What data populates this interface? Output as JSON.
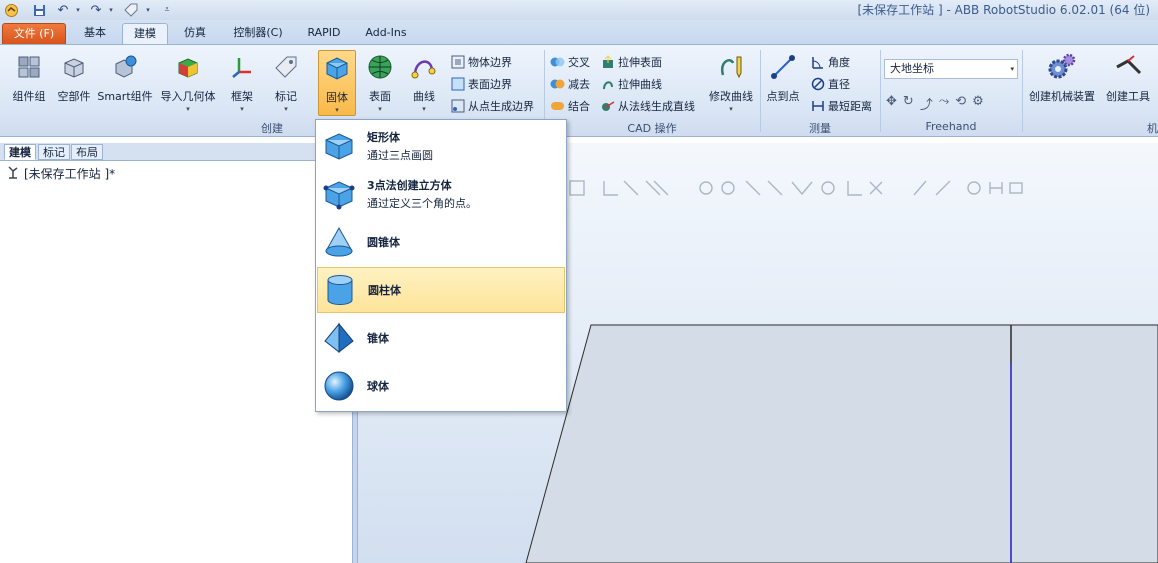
{
  "window": {
    "title": "[未保存工作站 ] - ABB RobotStudio 6.02.01 (64 位)"
  },
  "tabs": [
    {
      "label": "文件 (F)"
    },
    {
      "label": "基本"
    },
    {
      "label": "建模"
    },
    {
      "label": "仿真"
    },
    {
      "label": "控制器(C)"
    },
    {
      "label": "RAPID"
    },
    {
      "label": "Add-Ins"
    }
  ],
  "ribbon": {
    "create": {
      "label": "创建",
      "buttons": [
        {
          "label": "组件组"
        },
        {
          "label": "空部件"
        },
        {
          "label": "Smart组件"
        },
        {
          "label": "导入几何体"
        },
        {
          "label": "框架"
        },
        {
          "label": "标记"
        },
        {
          "label": "固体"
        },
        {
          "label": "表面"
        },
        {
          "label": "曲线"
        }
      ],
      "small": [
        {
          "label": "物体边界"
        },
        {
          "label": "表面边界"
        },
        {
          "label": "从点生成边界"
        }
      ]
    },
    "cad": {
      "label": "CAD 操作",
      "small": [
        {
          "label": "交叉"
        },
        {
          "label": "减去"
        },
        {
          "label": "结合"
        },
        {
          "label": "拉伸表面"
        },
        {
          "label": "拉伸曲线"
        },
        {
          "label": "从法线生成直线"
        }
      ],
      "modify": "修改曲线"
    },
    "measure": {
      "label": "测量",
      "point_to_point": "点到点",
      "small": [
        {
          "label": "角度"
        },
        {
          "label": "直径"
        },
        {
          "label": "最短距离"
        }
      ]
    },
    "freehand": {
      "label": "Freehand",
      "combo_value": "大地坐标"
    },
    "mechanism": {
      "label": "机械",
      "buttons": [
        {
          "label": "创建机械装置"
        },
        {
          "label": "创建工具"
        }
      ]
    }
  },
  "left": {
    "tabs": [
      {
        "label": "建模"
      },
      {
        "label": "标记"
      },
      {
        "label": "布局"
      }
    ],
    "tree_root": "[未保存工作站 ]*"
  },
  "menu": {
    "items": [
      {
        "title": "矩形体",
        "desc": "通过三点画圆"
      },
      {
        "title": "3点法创建立方体",
        "desc": "通过定义三个角的点。"
      },
      {
        "title": "圆锥体",
        "desc": ""
      },
      {
        "title": "圆柱体",
        "desc": ""
      },
      {
        "title": "锥体",
        "desc": ""
      },
      {
        "title": "球体",
        "desc": ""
      }
    ]
  },
  "colors": {
    "accent": "#d8531d",
    "highlight": "#fde49a",
    "ribbon": "#dae6f5"
  }
}
